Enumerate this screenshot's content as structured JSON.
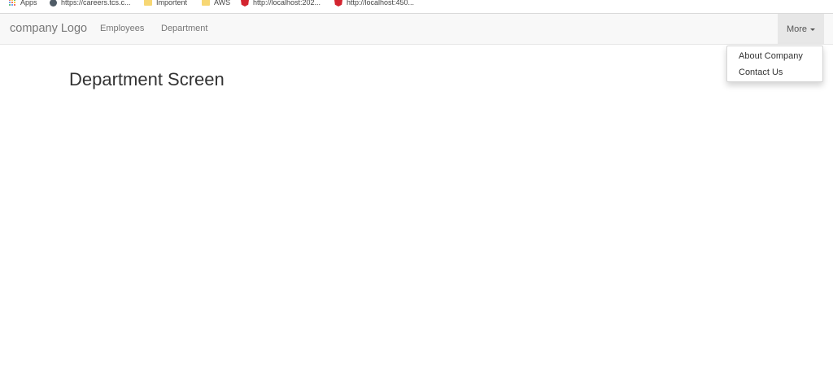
{
  "bookmarks": [
    {
      "label": "Apps",
      "icon": "apps-icon"
    },
    {
      "label": "https://careers.tcs.c...",
      "icon": "globe-icon"
    },
    {
      "label": "Importent",
      "icon": "folder-icon"
    },
    {
      "label": "AWS",
      "icon": "folder-icon"
    },
    {
      "label": "http://localhost:202...",
      "icon": "angular-icon"
    },
    {
      "label": "http://localhost:450...",
      "icon": "angular-icon"
    }
  ],
  "navbar": {
    "brand": "company Logo",
    "links": [
      "Employees",
      "Department"
    ],
    "more_label": "More"
  },
  "dropdown": {
    "items": [
      "About Company",
      "Contact Us"
    ]
  },
  "main": {
    "title": "Department Screen"
  },
  "colors": {
    "navbar_bg": "#f8f8f8",
    "active_toggle_bg": "#e7e7e7",
    "angular_red": "#d3242f",
    "folder_yellow": "#f7d774"
  }
}
